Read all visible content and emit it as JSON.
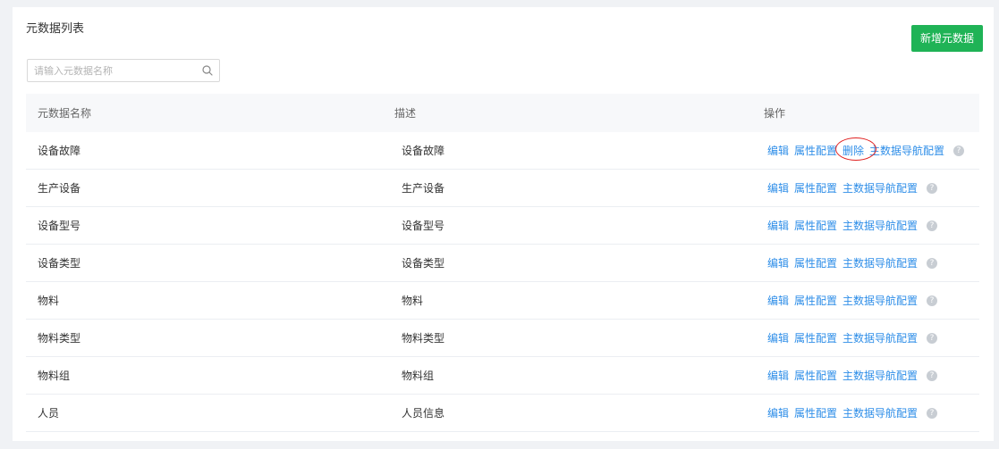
{
  "page": {
    "title": "元数据列表",
    "add_button_label": "新增元数据"
  },
  "search": {
    "placeholder": "请输入元数据名称",
    "value": ""
  },
  "table": {
    "headers": [
      "元数据名称",
      "描述",
      "操作"
    ],
    "rows": [
      {
        "name": "设备故障",
        "desc": "设备故障",
        "has_delete": true
      },
      {
        "name": "生产设备",
        "desc": "生产设备",
        "has_delete": false
      },
      {
        "name": "设备型号",
        "desc": "设备型号",
        "has_delete": false
      },
      {
        "name": "设备类型",
        "desc": "设备类型",
        "has_delete": false
      },
      {
        "name": "物料",
        "desc": "物料",
        "has_delete": false
      },
      {
        "name": "物料类型",
        "desc": "物料类型",
        "has_delete": false
      },
      {
        "name": "物料组",
        "desc": "物料组",
        "has_delete": false
      },
      {
        "name": "人员",
        "desc": "人员信息",
        "has_delete": false
      }
    ],
    "actions": {
      "edit": "编辑",
      "attr_config": "属性配置",
      "delete": "删除",
      "nav_config": "主数据导航配置",
      "help": "?"
    }
  },
  "colors": {
    "primary_green": "#1fb356",
    "link_blue": "#2e8ee8",
    "highlight_red": "#e02020"
  }
}
